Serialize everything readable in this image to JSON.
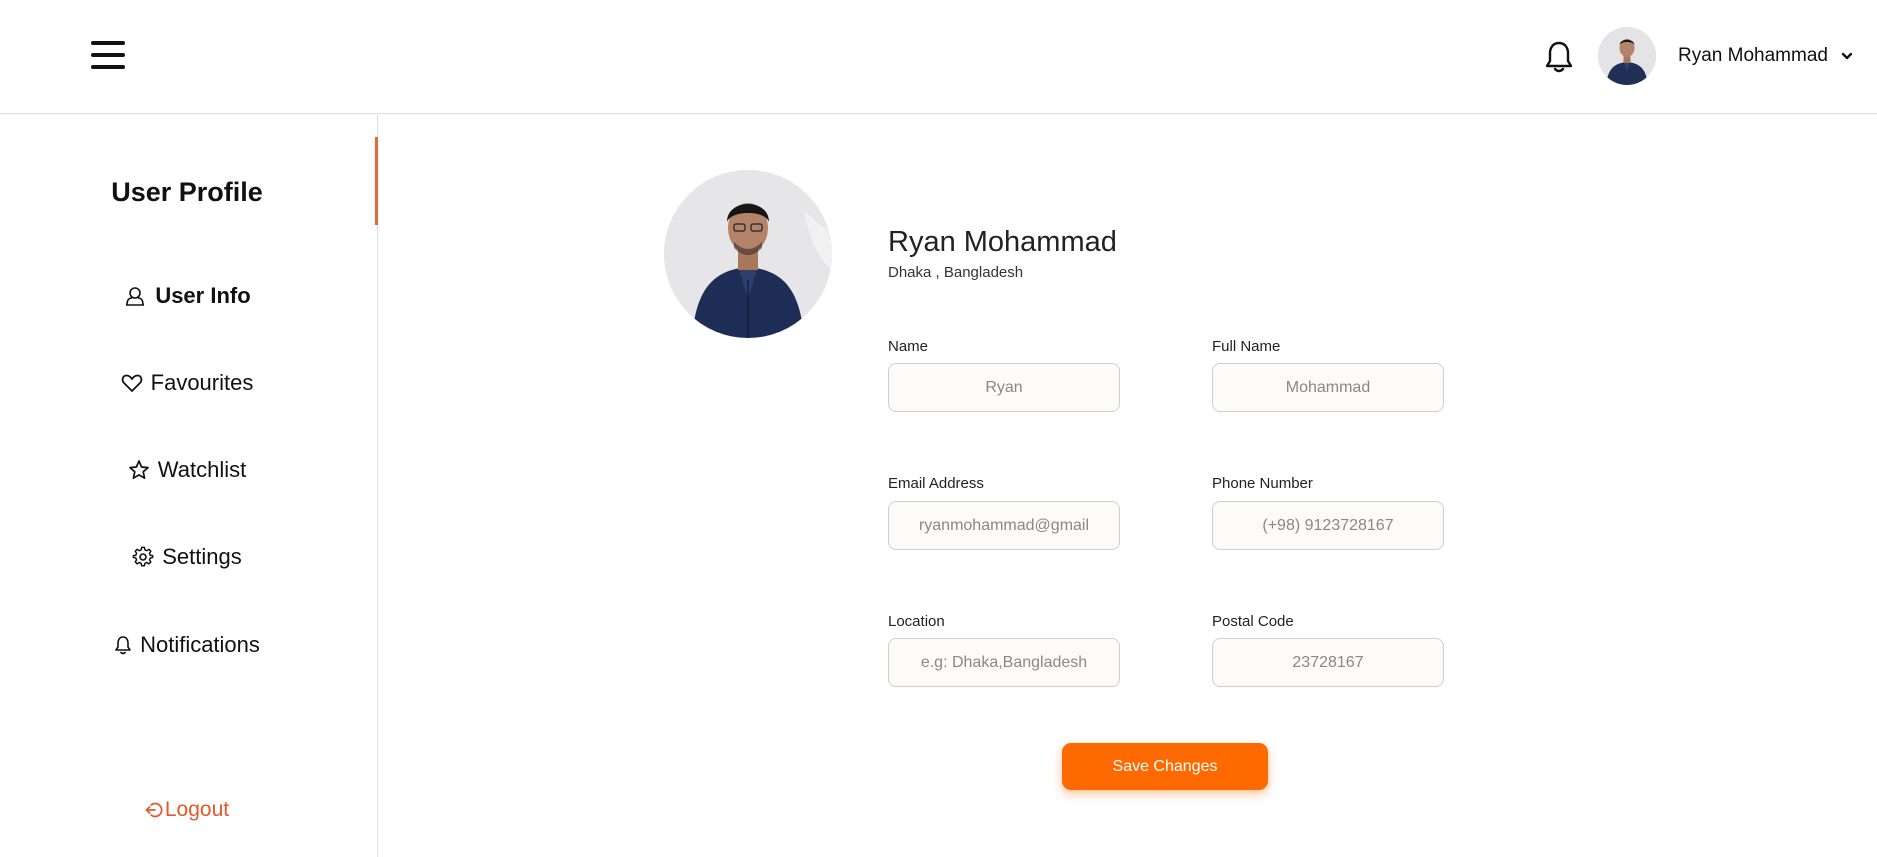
{
  "header": {
    "menu_icon": "hamburger-icon",
    "bell_icon": "bell-icon",
    "user_name": "Ryan Mohammad",
    "dropdown_icon": "chevron-down-icon"
  },
  "sidebar": {
    "title": "User Profile",
    "items": [
      {
        "label": "User Info",
        "icon": "user-icon",
        "active": true
      },
      {
        "label": "Favourites",
        "icon": "heart-icon",
        "active": false
      },
      {
        "label": "Watchlist",
        "icon": "star-icon",
        "active": false
      },
      {
        "label": "Settings",
        "icon": "gear-icon",
        "active": false
      },
      {
        "label": "Notifications",
        "icon": "bell-icon",
        "active": false
      }
    ],
    "logout_label": "Logout",
    "logout_icon": "logout-icon"
  },
  "profile": {
    "name": "Ryan Mohammad",
    "location": "Dhaka , Bangladesh"
  },
  "form": {
    "name": {
      "label": "Name",
      "placeholder": "Ryan"
    },
    "full_name": {
      "label": "Full Name",
      "placeholder": "Mohammad"
    },
    "email": {
      "label": "Email Address",
      "placeholder": "ryanmohammad@gmail"
    },
    "phone": {
      "label": "Phone Number",
      "placeholder": "(+98) 9123728167"
    },
    "location": {
      "label": "Location",
      "placeholder": "e.g: Dhaka,Bangladesh"
    },
    "postal": {
      "label": "Postal Code",
      "placeholder": "23728167"
    },
    "save_label": "Save Changes"
  },
  "colors": {
    "accent": "#ff6a00",
    "active_bar": "#e2693a",
    "logout": "#e2592a"
  }
}
